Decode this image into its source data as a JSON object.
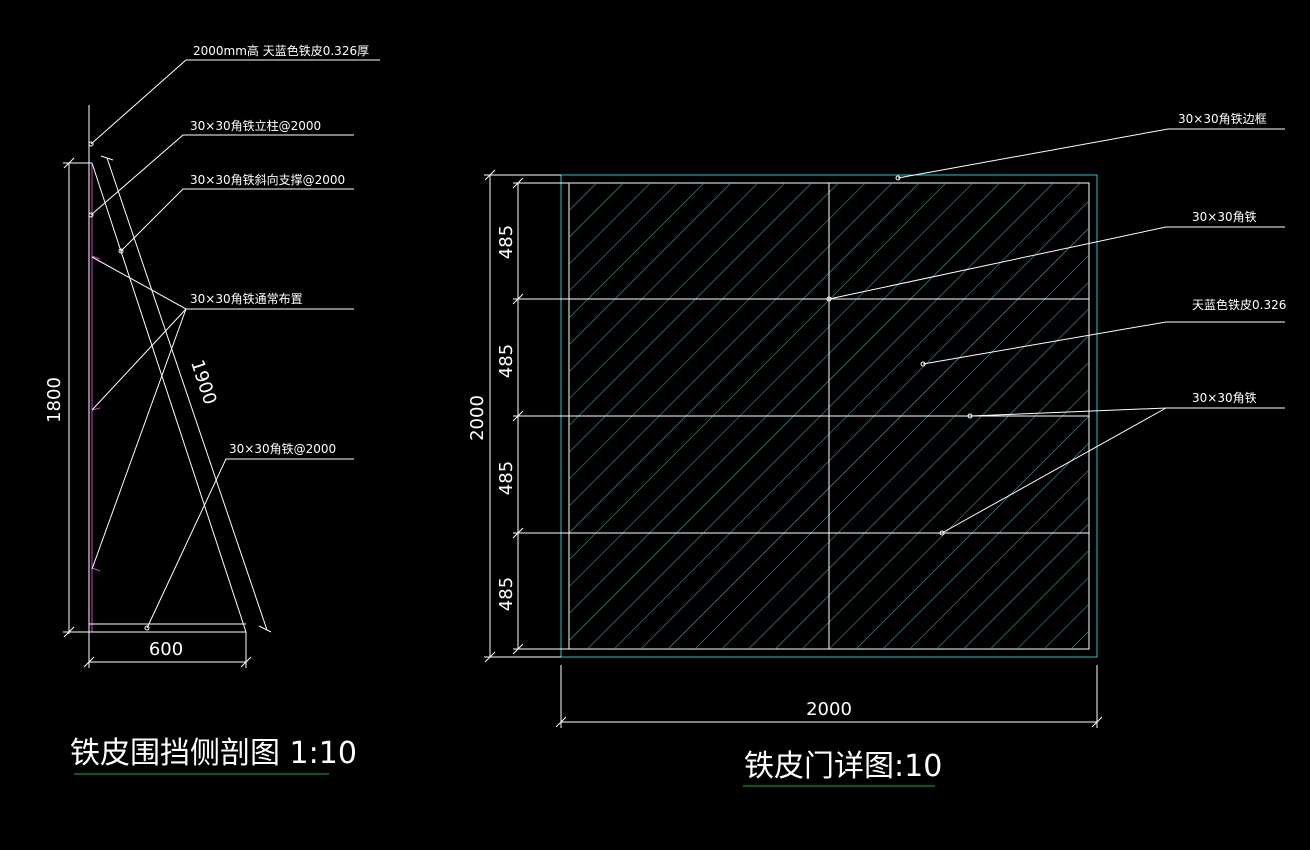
{
  "colors": {
    "background": "#000000",
    "line": "#ffffff",
    "hatch": "#23c2c8",
    "post": "#d63ad8",
    "underline": "#19b519"
  },
  "side_view": {
    "title": "铁皮围挡侧剖图 1:10",
    "labels": [
      "2000mm高 天蓝色铁皮0.326厚",
      "30×30角铁立柱@2000",
      "30×30角铁斜向支撑@2000",
      "30×30角铁通常布置",
      "30×30角铁@2000"
    ],
    "dims": {
      "height": "1800",
      "base": "600",
      "brace": "1900"
    }
  },
  "door_view": {
    "title": "铁皮门详图:10",
    "labels": [
      "30×30角铁边框",
      "30×30角铁",
      "天蓝色铁皮0.326",
      "30×30角铁"
    ],
    "dims": {
      "total_height": "2000",
      "width": "2000",
      "segments": [
        "485",
        "485",
        "485",
        "485"
      ]
    }
  }
}
